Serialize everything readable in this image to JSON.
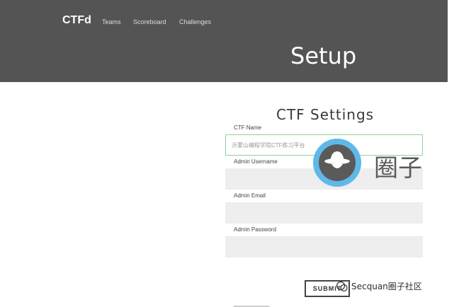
{
  "header": {
    "brand": "CTFd",
    "nav": [
      "Teams",
      "Scoreboard",
      "Challenges"
    ],
    "page_title": "Setup"
  },
  "form": {
    "title": "CTF Settings",
    "ctf_name_label": "CTF Name",
    "ctf_name_placeholder": "沂蒙山编程学院CTF练习平台",
    "admin_username_label": "Admin Username",
    "admin_email_label": "Admin Email",
    "admin_password_label": "Admin Password",
    "submit_label": "SUBMIT"
  },
  "watermark": {
    "logo_text": "圈子",
    "footer_text": "Secquan圈子社区"
  },
  "colors": {
    "header_bg": "#545454",
    "active_border": "#8fd29a",
    "field_bg": "#eeeeee",
    "logo_ring": "#5fb8e8"
  }
}
